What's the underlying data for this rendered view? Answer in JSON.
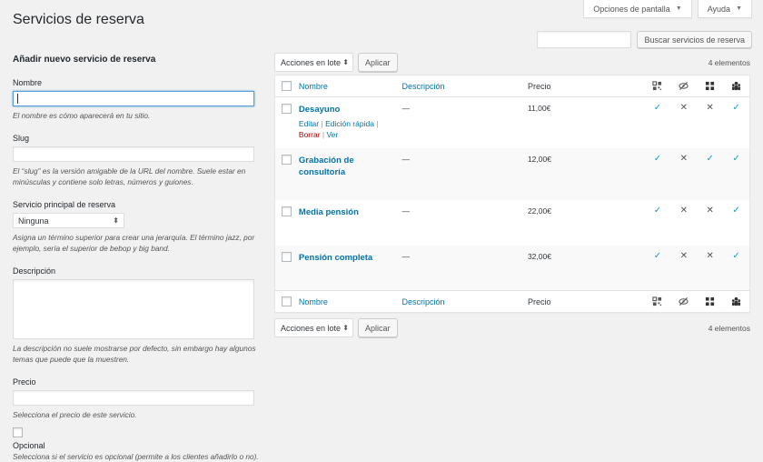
{
  "page": {
    "title": "Servicios de reserva"
  },
  "screen_meta": {
    "options_label": "Opciones de pantalla",
    "help_label": "Ayuda"
  },
  "search": {
    "value": "",
    "button_label": "Buscar servicios de reserva"
  },
  "form": {
    "heading": "Añadir nuevo servicio de reserva",
    "name_label": "Nombre",
    "name_help": "El nombre es cómo aparecerá en tu sitio.",
    "slug_label": "Slug",
    "slug_help": "El “slug” es la versión amigable de la URL del nombre. Suele estar en minúsculas y contiene solo letras, números y guiones.",
    "parent_label": "Servicio principal de reserva",
    "parent_value": "Ninguna",
    "parent_help": "Asigna un término superior para crear una jerarquía. El término jazz, por ejemplo, sería el superior de bebop y big band.",
    "desc_label": "Descripción",
    "desc_help": "La descripción no suele mostrarse por defecto, sin embargo hay algunos temas que puede que la muestren.",
    "price_label": "Precio",
    "price_help": "Selecciona el precio de este servicio.",
    "optional_label": "Opcional",
    "optional_help": "Selecciona si el servicio es opcional (permite a los clientes añadirlo o no)."
  },
  "tablenav": {
    "bulk_label": "Acciones en lote",
    "apply_label": "Aplicar",
    "count": "4 elementos"
  },
  "table": {
    "columns": {
      "name": "Nombre",
      "description": "Descripción",
      "price": "Precio"
    },
    "row_actions": {
      "edit": "Editar",
      "quick_edit": "Edición rápida",
      "delete": "Borrar",
      "view": "Ver"
    },
    "rows": [
      {
        "name": "Desayuno",
        "description": "—",
        "price": "11,00€",
        "flags": [
          "check",
          "cross",
          "cross",
          "check"
        ]
      },
      {
        "name": "Grabación de consultoría",
        "description": "—",
        "price": "12,00€",
        "flags": [
          "check",
          "cross",
          "check",
          "check"
        ]
      },
      {
        "name": "Media pensión",
        "description": "—",
        "price": "22,00€",
        "flags": [
          "check",
          "cross",
          "cross",
          "check"
        ]
      },
      {
        "name": "Pensión completa",
        "description": "—",
        "price": "32,00€",
        "flags": [
          "check",
          "cross",
          "cross",
          "check"
        ]
      }
    ]
  },
  "icons": {
    "col1": "qr-grid-icon",
    "col2": "eye-slash-icon",
    "col3": "four-squares-icon",
    "col4": "group-icon"
  },
  "colors": {
    "link": "#0073aa",
    "check": "#0ea0d8",
    "delete": "#a00"
  }
}
